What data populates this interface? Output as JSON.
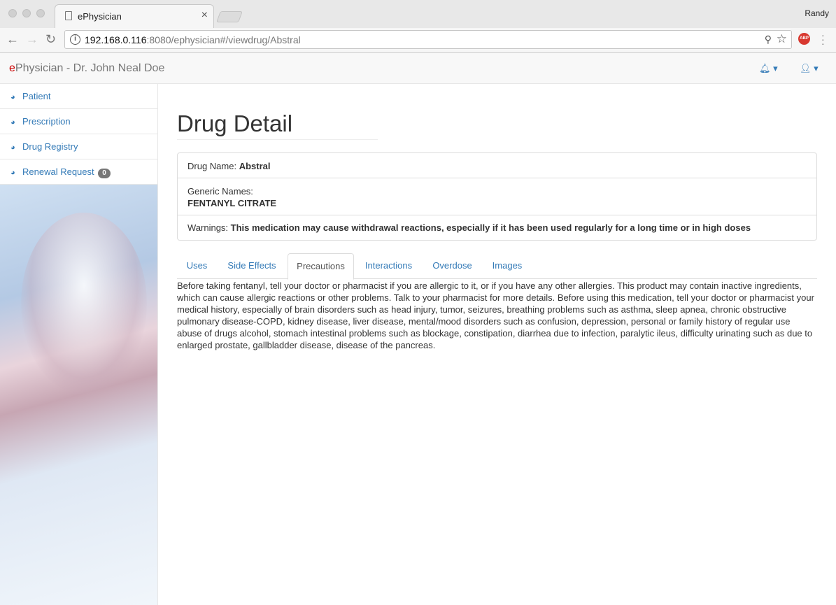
{
  "browser": {
    "tab_title": "ePhysician",
    "profile_name": "Randy",
    "url_host": "192.168.0.116",
    "url_rest": ":8080/ephysician#/viewdrug/Abstral",
    "abp_label": "ABP"
  },
  "app": {
    "brand_e": "e",
    "brand_rest": "Physician - Dr. John Neal Doe"
  },
  "sidebar": {
    "items": [
      {
        "label": "Patient"
      },
      {
        "label": "Prescription"
      },
      {
        "label": "Drug Registry"
      },
      {
        "label": "Renewal Request",
        "badge": "0"
      }
    ]
  },
  "main": {
    "title": "Drug Detail",
    "drug_name_label": "Drug Name:",
    "drug_name": "Abstral",
    "generic_label": "Generic Names:",
    "generic_name": "FENTANYL CITRATE",
    "warnings_label": "Warnings:",
    "warnings": "This medication may cause withdrawal reactions, especially if it has been used regularly for a long time or in high doses",
    "tabs": [
      {
        "label": "Uses"
      },
      {
        "label": "Side Effects"
      },
      {
        "label": "Precautions",
        "active": true
      },
      {
        "label": "Interactions"
      },
      {
        "label": "Overdose"
      },
      {
        "label": "Images"
      }
    ],
    "content": "Before taking fentanyl, tell your doctor or pharmacist if you are allergic to it, or if you have any other allergies. This product may contain inactive ingredients, which can cause allergic reactions or other problems. Talk to your pharmacist for more details. Before using this medication, tell your doctor or pharmacist your medical history, especially of brain disorders such as head injury, tumor, seizures, breathing problems such as asthma, sleep apnea, chronic obstructive pulmonary disease-COPD, kidney disease, liver disease, mental/mood disorders such as confusion, depression, personal or family history of regular use abuse of drugs alcohol, stomach intestinal problems such as blockage, constipation, diarrhea due to infection, paralytic ileus, difficulty urinating such as due to enlarged prostate, gallbladder disease, disease of the pancreas."
  },
  "colors": {
    "link": "#337ab7",
    "brand_accent": "#cc0000",
    "badge": "#777777"
  },
  "icons": [
    "document-icon",
    "close-icon",
    "back-icon",
    "forward-icon",
    "reload-icon",
    "info-icon",
    "zoom-icon",
    "star-icon",
    "adblock-icon",
    "menu-icon",
    "bell-icon",
    "user-icon",
    "dashboard-icon"
  ]
}
